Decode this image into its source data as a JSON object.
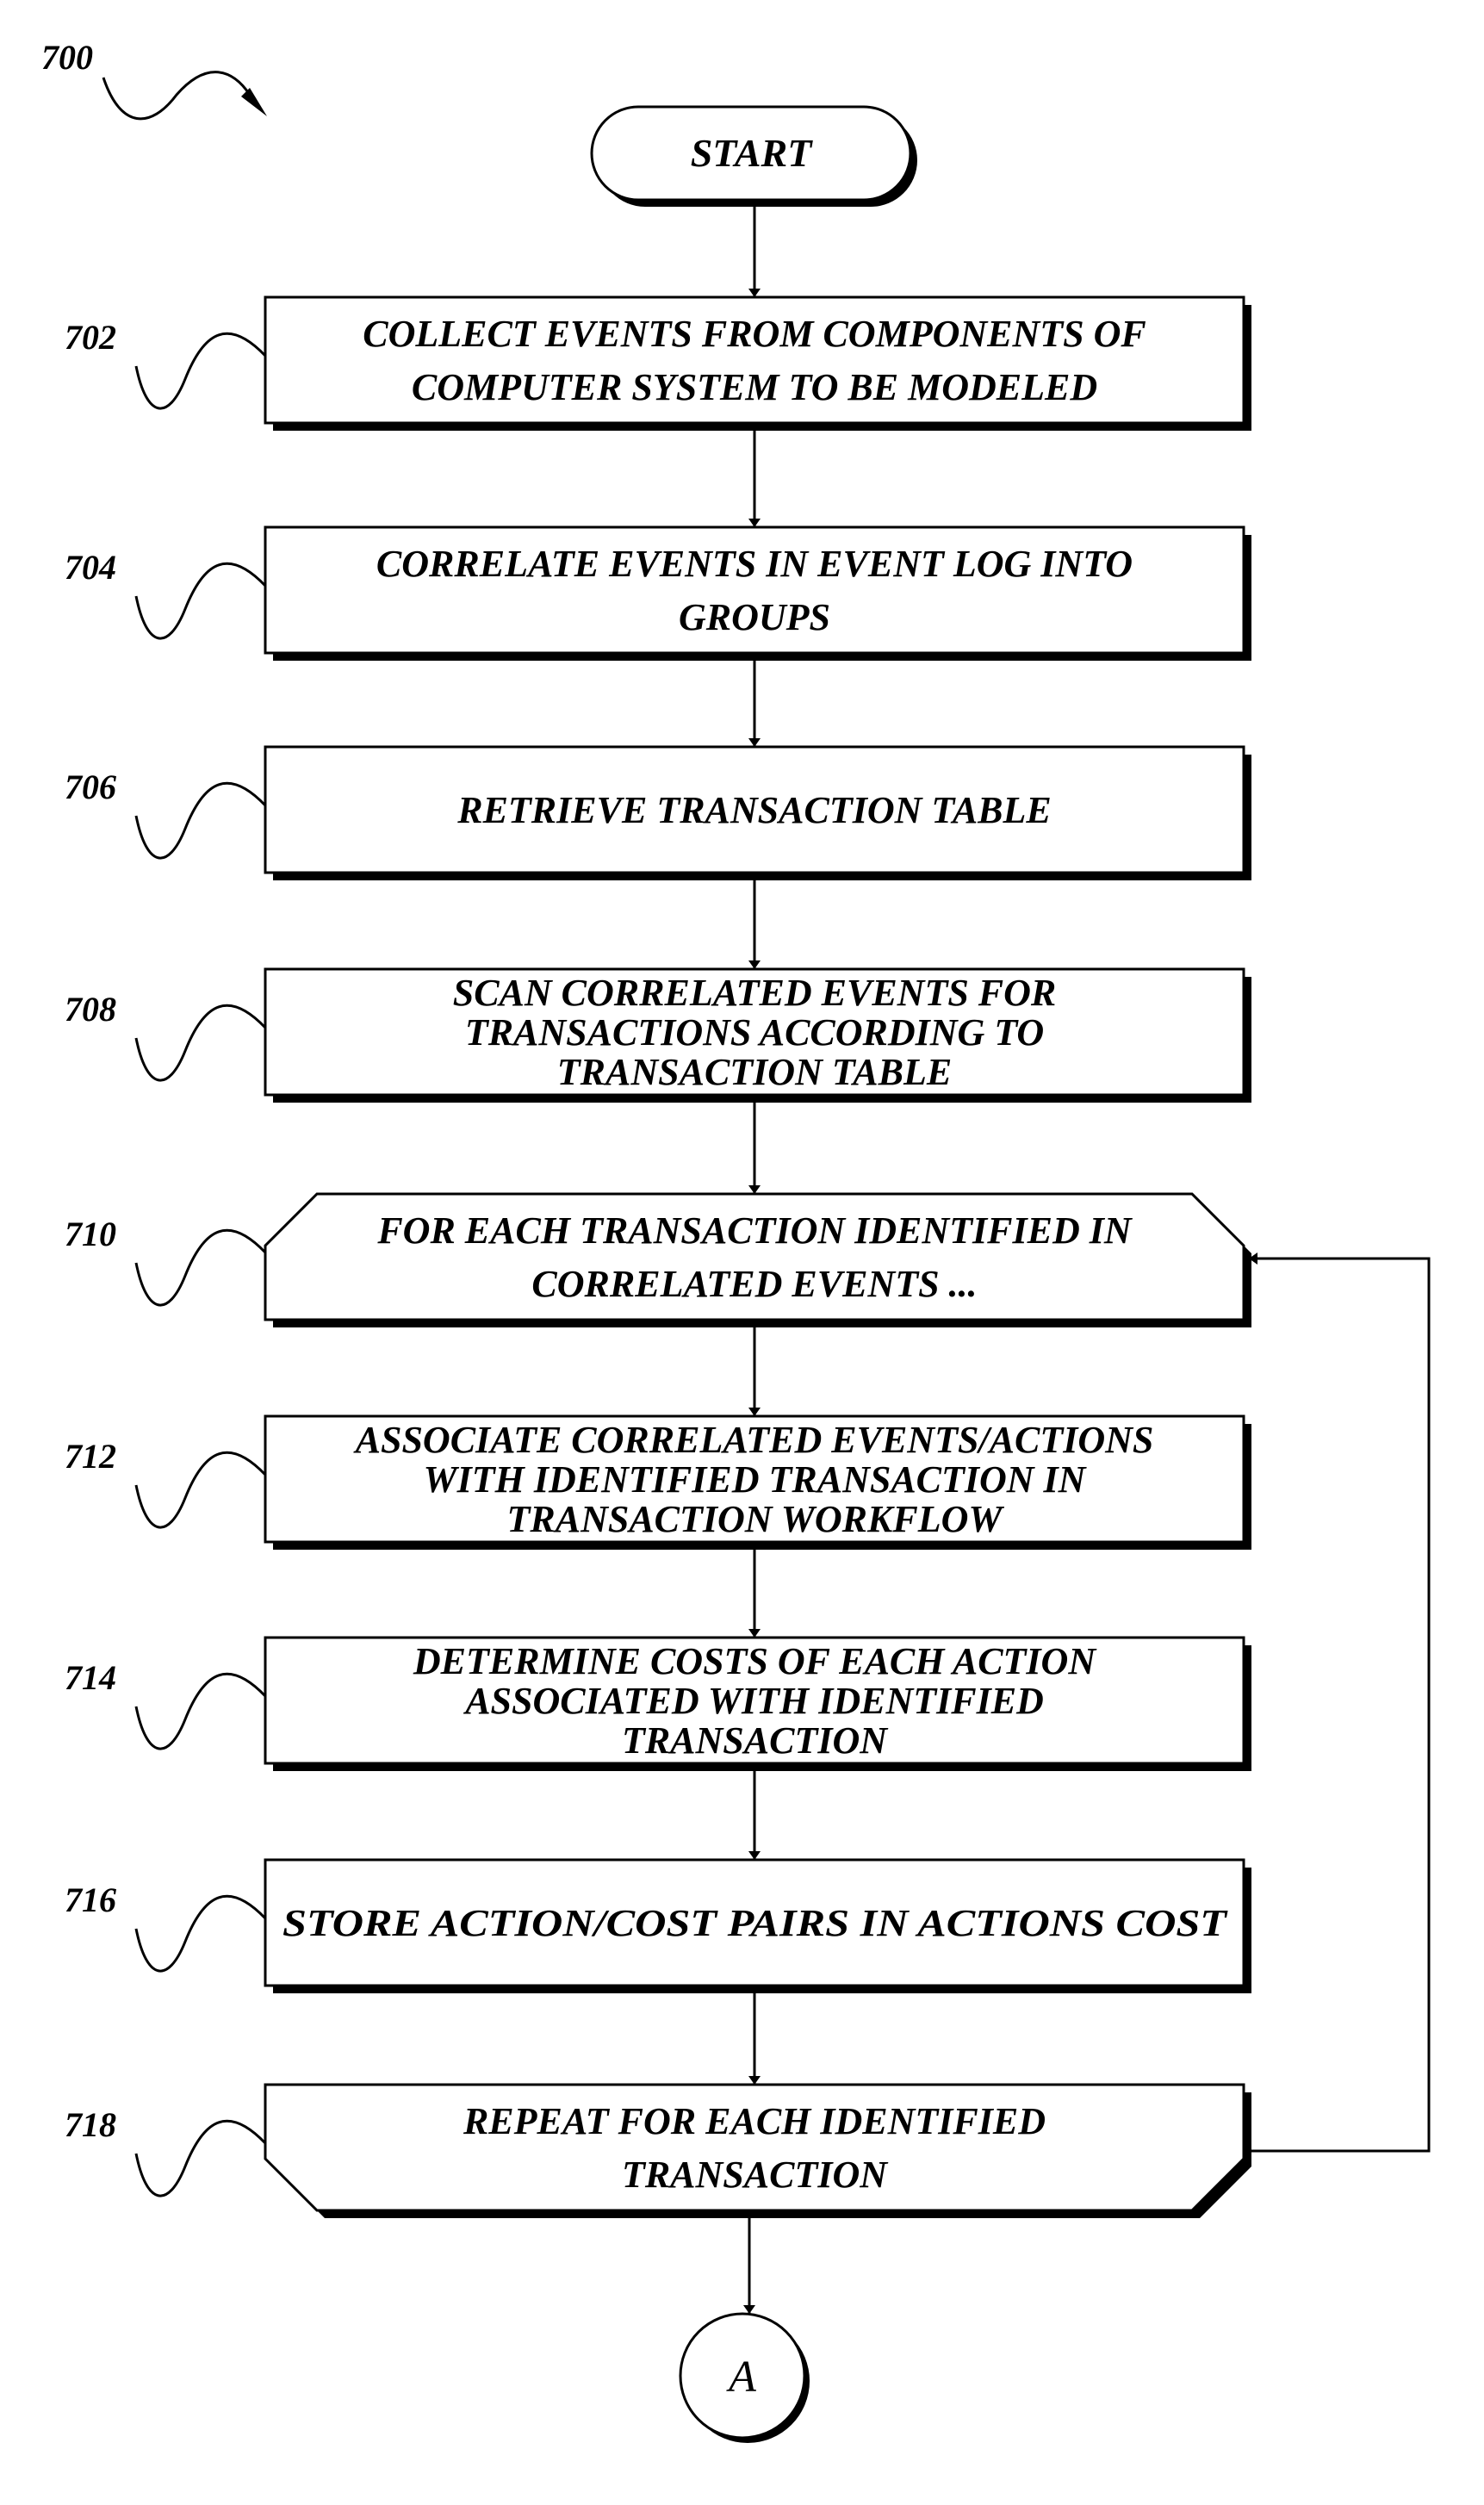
{
  "figure": {
    "reference": "700",
    "start_label": "START",
    "connector_label": "A",
    "steps": [
      {
        "ref": "702",
        "shape": "rect",
        "lines": [
          "COLLECT EVENTS FROM COMPONENTS OF",
          "COMPUTER SYSTEM TO BE MODELED"
        ]
      },
      {
        "ref": "704",
        "shape": "rect",
        "lines": [
          "CORRELATE EVENTS IN EVENT LOG INTO",
          "GROUPS"
        ]
      },
      {
        "ref": "706",
        "shape": "rect",
        "lines": [
          "RETRIEVE TRANSACTION TABLE"
        ]
      },
      {
        "ref": "708",
        "shape": "rect",
        "lines": [
          "SCAN CORRELATED EVENTS FOR",
          "TRANSACTIONS  ACCORDING TO",
          "TRANSACTION TABLE"
        ]
      },
      {
        "ref": "710",
        "shape": "loop-start",
        "lines": [
          "FOR EACH TRANSACTION IDENTIFIED IN",
          "CORRELATED EVENTS ..."
        ]
      },
      {
        "ref": "712",
        "shape": "rect",
        "lines": [
          "ASSOCIATE CORRELATED EVENTS/ACTIONS",
          "WITH IDENTIFIED TRANSACTION IN",
          "TRANSACTION WORKFLOW"
        ]
      },
      {
        "ref": "714",
        "shape": "rect",
        "lines": [
          "DETERMINE COSTS OF EACH ACTION",
          "ASSOCIATED WITH IDENTIFIED",
          "TRANSACTION"
        ]
      },
      {
        "ref": "716",
        "shape": "rect",
        "lines": [
          "STORE ACTION/COST PAIRS IN ACTIONS COST"
        ]
      },
      {
        "ref": "718",
        "shape": "loop-end",
        "lines": [
          "REPEAT FOR EACH IDENTIFIED",
          "TRANSACTION"
        ]
      }
    ],
    "loop_back": {
      "from": "718",
      "to": "710"
    }
  }
}
